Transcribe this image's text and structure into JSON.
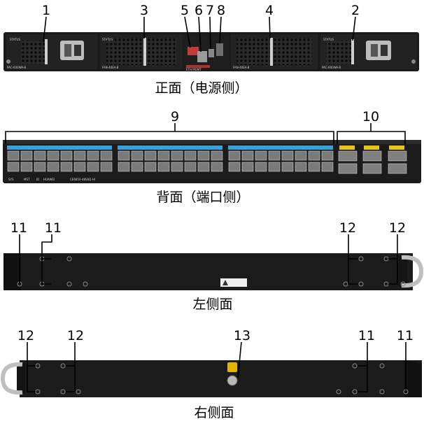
{
  "callouts": {
    "front": [
      "1",
      "3",
      "5",
      "6",
      "7",
      "8",
      "4",
      "2"
    ],
    "back": [
      "9",
      "10"
    ],
    "left": [
      "11",
      "11",
      "12",
      "12"
    ],
    "right": [
      "12",
      "12",
      "13",
      "11",
      "11"
    ]
  },
  "captions": {
    "front": "正面（电源侧）",
    "back": "背面（端口侧）",
    "left": "左侧面",
    "right": "右侧面"
  },
  "front_labels": {
    "status": "STATUS",
    "psu_left_model": "PAC-600WA-B",
    "psu_right_model": "PAC-600WA-B",
    "fan_model": "FAN-40EA-B",
    "mgmt": "ETH MGMT"
  },
  "back_labels": {
    "indicators": [
      "SYS",
      "MST",
      "ID"
    ],
    "brand": "HUAWEI",
    "model": "CE6850-48S6Q-HI"
  },
  "colors": {
    "chassis": "#1b1b1b",
    "port_label_blue": "#3aa0d8",
    "qsfp_label_yellow": "#e8c31a",
    "ground_yellow": "#e0b400"
  }
}
